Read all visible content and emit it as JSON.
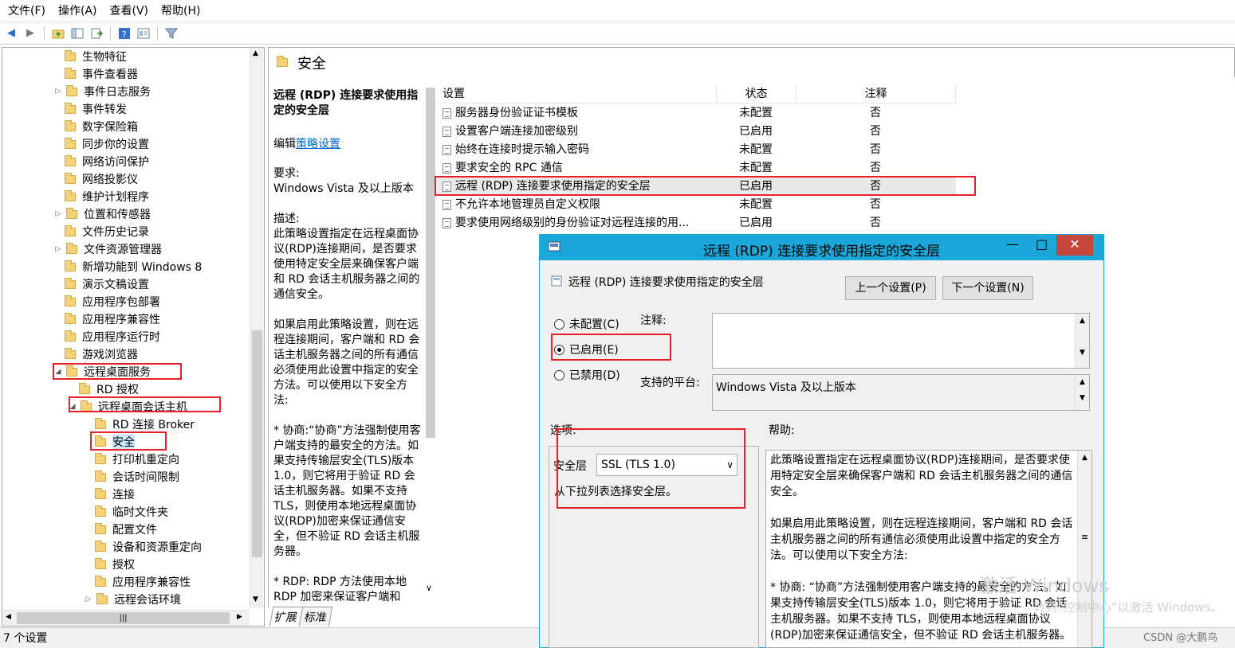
{
  "menu": [
    "文件(F)",
    "操作(A)",
    "查看(V)",
    "帮助(H)"
  ],
  "tree": {
    "items": [
      {
        "label": "生物特征",
        "arrow": ""
      },
      {
        "label": "事件查看器",
        "arrow": ""
      },
      {
        "label": "事件日志服务",
        "arrow": "▷"
      },
      {
        "label": "事件转发",
        "arrow": ""
      },
      {
        "label": "数字保险箱",
        "arrow": ""
      },
      {
        "label": "同步你的设置",
        "arrow": ""
      },
      {
        "label": "网络访问保护",
        "arrow": ""
      },
      {
        "label": "网络投影仪",
        "arrow": ""
      },
      {
        "label": "维护计划程序",
        "arrow": ""
      },
      {
        "label": "位置和传感器",
        "arrow": "▷"
      },
      {
        "label": "文件历史记录",
        "arrow": ""
      },
      {
        "label": "文件资源管理器",
        "arrow": "▷"
      },
      {
        "label": "新增功能到 Windows 8",
        "arrow": ""
      },
      {
        "label": "演示文稿设置",
        "arrow": ""
      },
      {
        "label": "应用程序包部署",
        "arrow": ""
      },
      {
        "label": "应用程序兼容性",
        "arrow": ""
      },
      {
        "label": "应用程序运行时",
        "arrow": ""
      },
      {
        "label": "游戏浏览器",
        "arrow": ""
      },
      {
        "label": "远程桌面服务",
        "arrow": "◢"
      },
      {
        "label": "RD 授权",
        "arrow": ""
      },
      {
        "label": "远程桌面会话主机",
        "arrow": "◢"
      },
      {
        "label": "RD 连接 Broker",
        "arrow": ""
      },
      {
        "label": "安全",
        "arrow": ""
      },
      {
        "label": "打印机重定向",
        "arrow": ""
      },
      {
        "label": "会话时间限制",
        "arrow": ""
      },
      {
        "label": "连接",
        "arrow": ""
      },
      {
        "label": "临时文件夹",
        "arrow": ""
      },
      {
        "label": "配置文件",
        "arrow": ""
      },
      {
        "label": "设备和资源重定向",
        "arrow": ""
      },
      {
        "label": "授权",
        "arrow": ""
      },
      {
        "label": "应用程序兼容性",
        "arrow": ""
      },
      {
        "label": "远程会话环境",
        "arrow": "▷"
      }
    ],
    "hscroll_glyph": "|||"
  },
  "content": {
    "folder_title": "安全",
    "desc": {
      "title": "远程 (RDP) 连接要求使用指定的安全层",
      "edit_prefix": "编辑",
      "edit_link": "策略设置",
      "req_label": "要求:",
      "req_value": "Windows Vista 及以上版本",
      "desc_label": "描述:",
      "p1": "此策略设置指定在远程桌面协议(RDP)连接期间，是否要求使用特定安全层来确保客户端和 RD 会话主机服务器之间的通信安全。",
      "p2": "如果启用此策略设置，则在远程连接期间，客户端和 RD 会话主机服务器之间的所有通信必须使用此设置中指定的安全方法。可以使用以下安全方法:",
      "p3": "* 协商:“协商”方法强制使用客户端支持的最安全的方法。如果支持传输层安全(TLS)版本 1.0，则它将用于验证 RD 会话主机服务器。如果不支持 TLS，则使用本地远程桌面协议(RDP)加密来保证通信安全，但不验证 RD 会话主机服务器。",
      "p4": "* RDP: RDP 方法使用本地 RDP 加密来保证客户端和"
    },
    "columns": [
      "设置",
      "状态",
      "注释"
    ],
    "rows": [
      {
        "name": "服务器身份验证证书模板",
        "state": "未配置",
        "note": "否"
      },
      {
        "name": "设置客户端连接加密级别",
        "state": "已启用",
        "note": "否"
      },
      {
        "name": "始终在连接时提示输入密码",
        "state": "未配置",
        "note": "否"
      },
      {
        "name": "要求安全的 RPC 通信",
        "state": "未配置",
        "note": "否"
      },
      {
        "name": "远程 (RDP) 连接要求使用指定的安全层",
        "state": "已启用",
        "note": "否"
      },
      {
        "name": "不允许本地管理员自定义权限",
        "state": "未配置",
        "note": "否"
      },
      {
        "name": "要求使用网络级别的身份验证对远程连接的用...",
        "state": "已启用",
        "note": "否"
      }
    ],
    "tabs": [
      "扩展",
      "标准"
    ]
  },
  "status": "7 个设置",
  "dialog": {
    "title": "远程 (RDP) 连接要求使用指定的安全层",
    "setting_name": "远程 (RDP) 连接要求使用指定的安全层",
    "prev_button": "上一个设置(P)",
    "next_button": "下一个设置(N)",
    "radio_not_configured": "未配置(C)",
    "radio_enabled": "已启用(E)",
    "radio_disabled": "已禁用(D)",
    "comment_label": "注释:",
    "platform_label": "支持的平台:",
    "platform_value": "Windows Vista 及以上版本",
    "options_label": "选项:",
    "help_label": "帮助:",
    "security_layer_label": "安全层",
    "security_layer_value": "SSL (TLS 1.0)",
    "options_hint": "从下拉列表选择安全层。",
    "help_p1": "此策略设置指定在远程桌面协议(RDP)连接期间，是否要求使用特定安全层来确保客户端和 RD 会话主机服务器之间的通信安全。",
    "help_p2": "如果启用此策略设置，则在远程连接期间，客户端和 RD 会话主机服务器之间的所有通信必须使用此设置中指定的安全方法。可以使用以下安全方法:",
    "help_p3": "* 协商: “协商”方法强制使用客户端支持的最安全的方法。如果支持传输层安全(TLS)版本 1.0，则它将用于验证 RD 会话主机服务器。如果不支持 TLS，则使用本地远程桌面协议(RDP)加密来保证通信安全，但不验证 RD 会话主机服务器。"
  },
  "watermark": {
    "line1": "激活 Windows",
    "line2": "转到“控制中心”以激活 Windows。"
  },
  "credit": "CSDN @大鹏鸟",
  "colors": {
    "title_bar": "#1aa7d9",
    "close_button": "#c7463b",
    "highlight_box": "#e8202a",
    "selection": "#cce8ff"
  }
}
